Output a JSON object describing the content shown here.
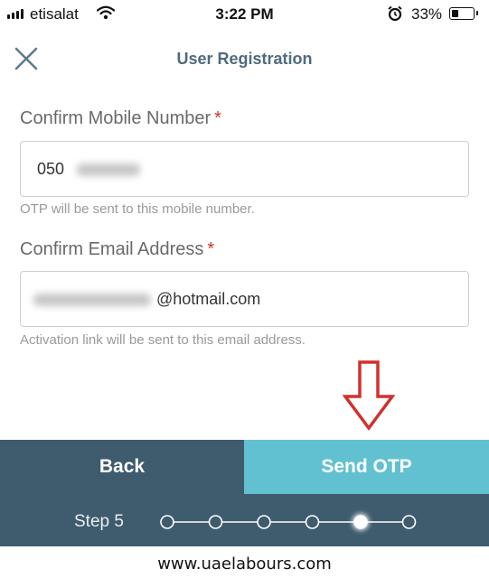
{
  "status_bar": {
    "carrier": "etisalat",
    "time": "3:22 PM",
    "battery_percent": "33%",
    "battery_level": 0.33,
    "icons": [
      "signal-icon",
      "wifi-icon",
      "alarm-icon",
      "battery-icon"
    ]
  },
  "header": {
    "title": "User Registration",
    "close_icon": "close-icon"
  },
  "form": {
    "mobile": {
      "label": "Confirm Mobile Number",
      "required_mark": "*",
      "value": "050",
      "hint": "OTP will be sent to this mobile number."
    },
    "email": {
      "label": "Confirm Email Address",
      "required_mark": "*",
      "value": "@hotmail.com",
      "hint": "Activation link will be sent to this email address."
    }
  },
  "buttons": {
    "back_label": "Back",
    "send_label": "Send OTP"
  },
  "steps": {
    "label": "Step 5",
    "total": 6,
    "current": 5
  },
  "watermark": "www.uaelabours.com",
  "colors": {
    "primary_dark": "#3f5b6e",
    "accent": "#62c1d0",
    "required": "#d0312d",
    "arrow": "#d0312d"
  }
}
